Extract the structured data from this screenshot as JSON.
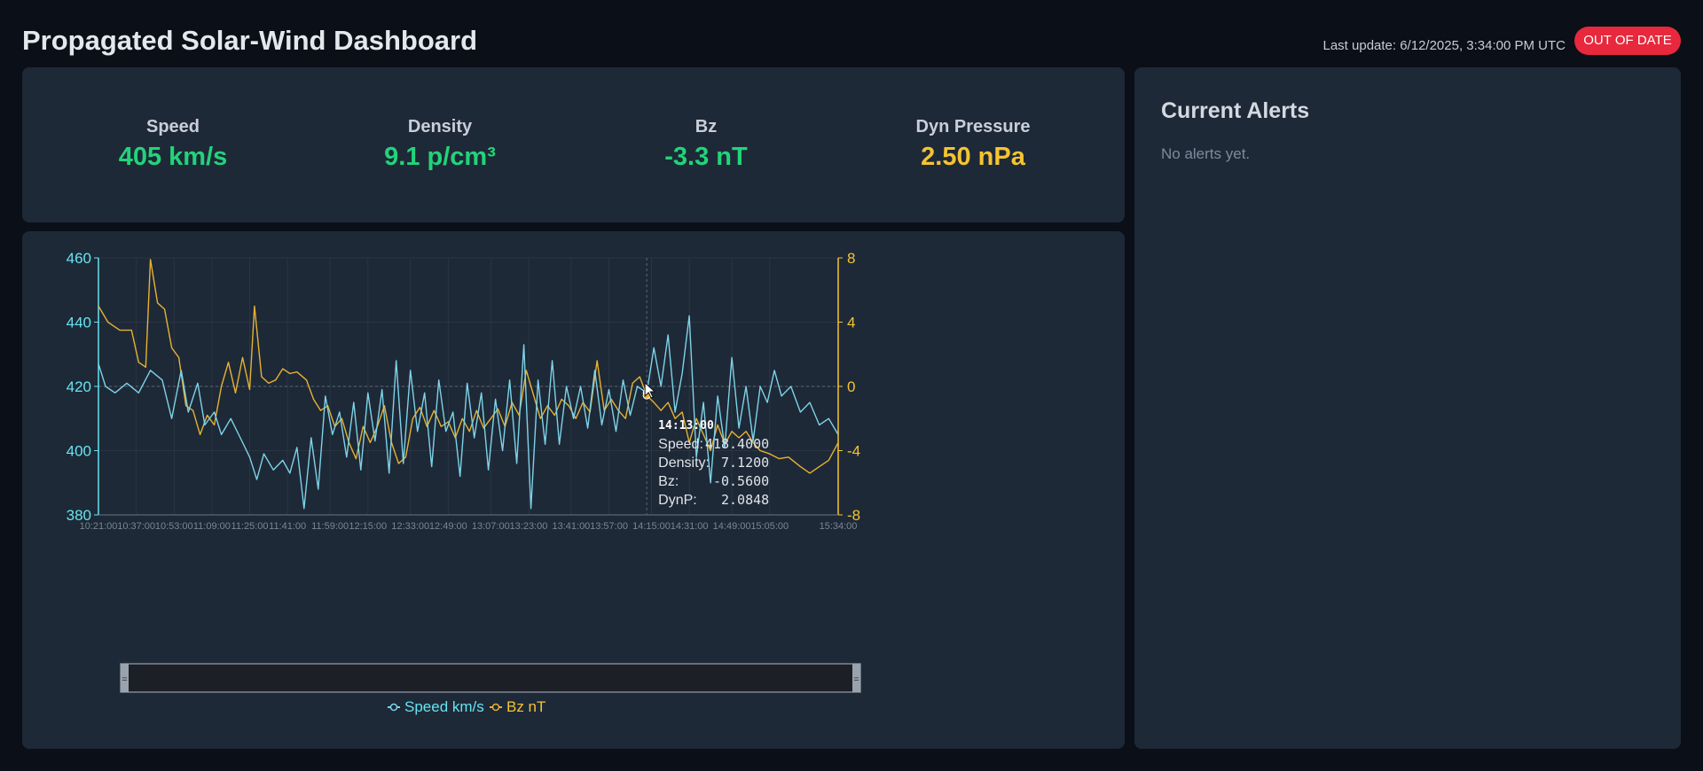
{
  "header": {
    "title": "Propagated Solar-Wind Dashboard",
    "last_update": "Last update: 6/12/2025, 3:34:00 PM UTC",
    "status_badge": "OUT OF DATE"
  },
  "stats": [
    {
      "label": "Speed",
      "value": "405 km/s",
      "color": "#22d47a"
    },
    {
      "label": "Density",
      "value": "9.1 p/cm³",
      "color": "#22d47a"
    },
    {
      "label": "Bz",
      "value": "-3.3 nT",
      "color": "#22d47a"
    },
    {
      "label": "Dyn Pressure",
      "value": "2.50 nPa",
      "color": "#f4c431"
    }
  ],
  "alerts": {
    "title": "Current Alerts",
    "empty_text": "No alerts yet."
  },
  "legend": {
    "speed": "Speed km/s",
    "bz": "Bz nT"
  },
  "tooltip": {
    "time": "14:13:00",
    "rows": [
      {
        "label": "Speed:",
        "value": "418.4000"
      },
      {
        "label": "Density:",
        "value": "7.1200"
      },
      {
        "label": "Bz:",
        "value": "-0.5600"
      },
      {
        "label": "DynP:",
        "value": "2.0848"
      }
    ]
  },
  "colors": {
    "speed": "#7dd3e8",
    "bz": "#e6b233",
    "speed_axis": "#67e3f0",
    "bz_axis": "#f4c431"
  },
  "chart_data": {
    "type": "line",
    "x_start": "10:21:00",
    "x_end": "15:34:00",
    "x_step_minutes": 1,
    "xticks": [
      "10:21:00",
      "10:37:00",
      "10:53:00",
      "11:09:00",
      "11:25:00",
      "11:41:00",
      "11:59:00",
      "12:15:00",
      "12:33:00",
      "12:49:00",
      "13:07:00",
      "13:23:00",
      "13:41:00",
      "13:57:00",
      "14:15:00",
      "14:31:00",
      "14:49:00",
      "15:05:00",
      "15:34:00"
    ],
    "y_left": {
      "label": "",
      "min": 380,
      "max": 460,
      "ticks": [
        380,
        400,
        420,
        440,
        460
      ]
    },
    "y_right": {
      "label": "",
      "min": -8,
      "max": 8,
      "ticks": [
        -8,
        -4,
        0,
        4,
        8
      ]
    },
    "series": [
      {
        "name": "Speed km/s",
        "axis": "left",
        "keypoints": [
          [
            "10:21:00",
            427
          ],
          [
            "10:24:00",
            420
          ],
          [
            "10:28:00",
            418
          ],
          [
            "10:33:00",
            421
          ],
          [
            "10:38:00",
            418
          ],
          [
            "10:43:00",
            425
          ],
          [
            "10:48:00",
            422
          ],
          [
            "10:52:00",
            410
          ],
          [
            "10:56:00",
            425
          ],
          [
            "10:59:00",
            412
          ],
          [
            "11:03:00",
            421
          ],
          [
            "11:06:00",
            408
          ],
          [
            "11:10:00",
            412
          ],
          [
            "11:13:00",
            405
          ],
          [
            "11:17:00",
            410
          ],
          [
            "11:21:00",
            404
          ],
          [
            "11:25:00",
            398
          ],
          [
            "11:28:00",
            391
          ],
          [
            "11:31:00",
            399
          ],
          [
            "11:35:00",
            394
          ],
          [
            "11:39:00",
            397
          ],
          [
            "11:42:00",
            393
          ],
          [
            "11:45:00",
            401
          ],
          [
            "11:48:00",
            382
          ],
          [
            "11:51:00",
            404
          ],
          [
            "11:54:00",
            388
          ],
          [
            "11:57:00",
            417
          ],
          [
            "12:00:00",
            405
          ],
          [
            "12:03:00",
            412
          ],
          [
            "12:06:00",
            398
          ],
          [
            "12:09:00",
            415
          ],
          [
            "12:12:00",
            394
          ],
          [
            "12:15:00",
            418
          ],
          [
            "12:18:00",
            403
          ],
          [
            "12:21:00",
            419
          ],
          [
            "12:24:00",
            393
          ],
          [
            "12:27:00",
            428
          ],
          [
            "12:30:00",
            396
          ],
          [
            "12:33:00",
            425
          ],
          [
            "12:36:00",
            406
          ],
          [
            "12:39:00",
            418
          ],
          [
            "12:42:00",
            395
          ],
          [
            "12:45:00",
            422
          ],
          [
            "12:48:00",
            406
          ],
          [
            "12:51:00",
            412
          ],
          [
            "12:54:00",
            392
          ],
          [
            "12:57:00",
            421
          ],
          [
            "13:00:00",
            404
          ],
          [
            "13:03:00",
            418
          ],
          [
            "13:06:00",
            394
          ],
          [
            "13:09:00",
            416
          ],
          [
            "13:12:00",
            400
          ],
          [
            "13:15:00",
            422
          ],
          [
            "13:18:00",
            396
          ],
          [
            "13:21:00",
            433
          ],
          [
            "13:24:00",
            382
          ],
          [
            "13:27:00",
            422
          ],
          [
            "13:30:00",
            402
          ],
          [
            "13:33:00",
            428
          ],
          [
            "13:36:00",
            402
          ],
          [
            "13:39:00",
            420
          ],
          [
            "13:42:00",
            410
          ],
          [
            "13:45:00",
            420
          ],
          [
            "13:48:00",
            407
          ],
          [
            "13:51:00",
            425
          ],
          [
            "13:54:00",
            408
          ],
          [
            "13:57:00",
            419
          ],
          [
            "14:00:00",
            406
          ],
          [
            "14:03:00",
            422
          ],
          [
            "14:06:00",
            411
          ],
          [
            "14:09:00",
            420
          ],
          [
            "14:13:00",
            418
          ],
          [
            "14:16:00",
            432
          ],
          [
            "14:19:00",
            420
          ],
          [
            "14:22:00",
            436
          ],
          [
            "14:25:00",
            412
          ],
          [
            "14:28:00",
            424
          ],
          [
            "14:31:00",
            442
          ],
          [
            "14:34:00",
            398
          ],
          [
            "14:37:00",
            415
          ],
          [
            "14:40:00",
            390
          ],
          [
            "14:43:00",
            417
          ],
          [
            "14:46:00",
            401
          ],
          [
            "14:49:00",
            429
          ],
          [
            "14:52:00",
            407
          ],
          [
            "14:55:00",
            420
          ],
          [
            "14:58:00",
            403
          ],
          [
            "15:01:00",
            420
          ],
          [
            "15:04:00",
            415
          ],
          [
            "15:07:00",
            425
          ],
          [
            "15:10:00",
            417
          ],
          [
            "15:14:00",
            420
          ],
          [
            "15:18:00",
            412
          ],
          [
            "15:22:00",
            415
          ],
          [
            "15:26:00",
            408
          ],
          [
            "15:30:00",
            410
          ],
          [
            "15:34:00",
            405
          ]
        ]
      },
      {
        "name": "Bz nT",
        "axis": "right",
        "keypoints": [
          [
            "10:21:00",
            5
          ],
          [
            "10:25:00",
            4
          ],
          [
            "10:30:00",
            3.5
          ],
          [
            "10:35:00",
            3.5
          ],
          [
            "10:38:00",
            1.5
          ],
          [
            "10:41:00",
            1.2
          ],
          [
            "10:43:00",
            7.9
          ],
          [
            "10:46:00",
            5.2
          ],
          [
            "10:49:00",
            4.8
          ],
          [
            "10:52:00",
            2.4
          ],
          [
            "10:55:00",
            1.8
          ],
          [
            "10:58:00",
            -1.2
          ],
          [
            "11:01:00",
            -1.5
          ],
          [
            "11:04:00",
            -3
          ],
          [
            "11:07:00",
            -1.8
          ],
          [
            "11:10:00",
            -2.4
          ],
          [
            "11:13:00",
            0
          ],
          [
            "11:16:00",
            1.5
          ],
          [
            "11:19:00",
            -0.4
          ],
          [
            "11:22:00",
            1.8
          ],
          [
            "11:25:00",
            -0.2
          ],
          [
            "11:27:00",
            5
          ],
          [
            "11:30:00",
            0.6
          ],
          [
            "11:33:00",
            0.2
          ],
          [
            "11:36:00",
            0.4
          ],
          [
            "11:39:00",
            1.1
          ],
          [
            "11:42:00",
            0.8
          ],
          [
            "11:45:00",
            0.9
          ],
          [
            "11:49:00",
            0.4
          ],
          [
            "11:52:00",
            -0.8
          ],
          [
            "11:55:00",
            -1.5
          ],
          [
            "11:58:00",
            -1.2
          ],
          [
            "12:01:00",
            -2.5
          ],
          [
            "12:04:00",
            -2
          ],
          [
            "12:07:00",
            -3.5
          ],
          [
            "12:10:00",
            -4.5
          ],
          [
            "12:13:00",
            -2.5
          ],
          [
            "12:16:00",
            -3.5
          ],
          [
            "12:19:00",
            -2.5
          ],
          [
            "12:22:00",
            -1.2
          ],
          [
            "12:25:00",
            -3.5
          ],
          [
            "12:28:00",
            -4.8
          ],
          [
            "12:31:00",
            -4.4
          ],
          [
            "12:34:00",
            -2
          ],
          [
            "12:37:00",
            -1.3
          ],
          [
            "12:40:00",
            -2.5
          ],
          [
            "12:43:00",
            -1.5
          ],
          [
            "12:46:00",
            -2.5
          ],
          [
            "12:49:00",
            -2.2
          ],
          [
            "12:52:00",
            -3.2
          ],
          [
            "12:55:00",
            -2
          ],
          [
            "12:58:00",
            -2.8
          ],
          [
            "13:01:00",
            -1.5
          ],
          [
            "13:04:00",
            -2.6
          ],
          [
            "13:07:00",
            -2
          ],
          [
            "13:10:00",
            -1.4
          ],
          [
            "13:13:00",
            -2.5
          ],
          [
            "13:16:00",
            -1
          ],
          [
            "13:19:00",
            -1.8
          ],
          [
            "13:22:00",
            1
          ],
          [
            "13:25:00",
            -0.5
          ],
          [
            "13:28:00",
            -2
          ],
          [
            "13:31:00",
            -1.2
          ],
          [
            "13:34:00",
            -1.8
          ],
          [
            "13:37:00",
            -0.8
          ],
          [
            "13:40:00",
            -1.2
          ],
          [
            "13:43:00",
            -2
          ],
          [
            "13:46:00",
            -1
          ],
          [
            "13:49:00",
            -1.6
          ],
          [
            "13:52:00",
            1.6
          ],
          [
            "13:55:00",
            -1.5
          ],
          [
            "13:58:00",
            -0.8
          ],
          [
            "14:01:00",
            -1.5
          ],
          [
            "14:04:00",
            -2
          ],
          [
            "14:07:00",
            0.2
          ],
          [
            "14:10:00",
            0.6
          ],
          [
            "14:13:00",
            -0.56
          ],
          [
            "14:16:00",
            -1
          ],
          [
            "14:19:00",
            -1.5
          ],
          [
            "14:22:00",
            -1
          ],
          [
            "14:25:00",
            -2
          ],
          [
            "14:28:00",
            -1.6
          ],
          [
            "14:31:00",
            -3.5
          ],
          [
            "14:34:00",
            -2
          ],
          [
            "14:37:00",
            -3
          ],
          [
            "14:40:00",
            -4
          ],
          [
            "14:43:00",
            -2.4
          ],
          [
            "14:46:00",
            -3.6
          ],
          [
            "14:49:00",
            -2.8
          ],
          [
            "14:52:00",
            -3.2
          ],
          [
            "14:55:00",
            -2.8
          ],
          [
            "14:58:00",
            -3.5
          ],
          [
            "15:01:00",
            -4
          ],
          [
            "15:05:00",
            -4.2
          ],
          [
            "15:09:00",
            -4.5
          ],
          [
            "15:13:00",
            -4.4
          ],
          [
            "15:18:00",
            -5
          ],
          [
            "15:22:00",
            -5.4
          ],
          [
            "15:26:00",
            -5
          ],
          [
            "15:30:00",
            -4.6
          ],
          [
            "15:34:00",
            -3.5
          ]
        ]
      }
    ],
    "hover_time": "14:13:00",
    "reference_lines": {
      "speed": 420,
      "bz": 0
    },
    "grid": true,
    "legend_position": "bottom"
  }
}
